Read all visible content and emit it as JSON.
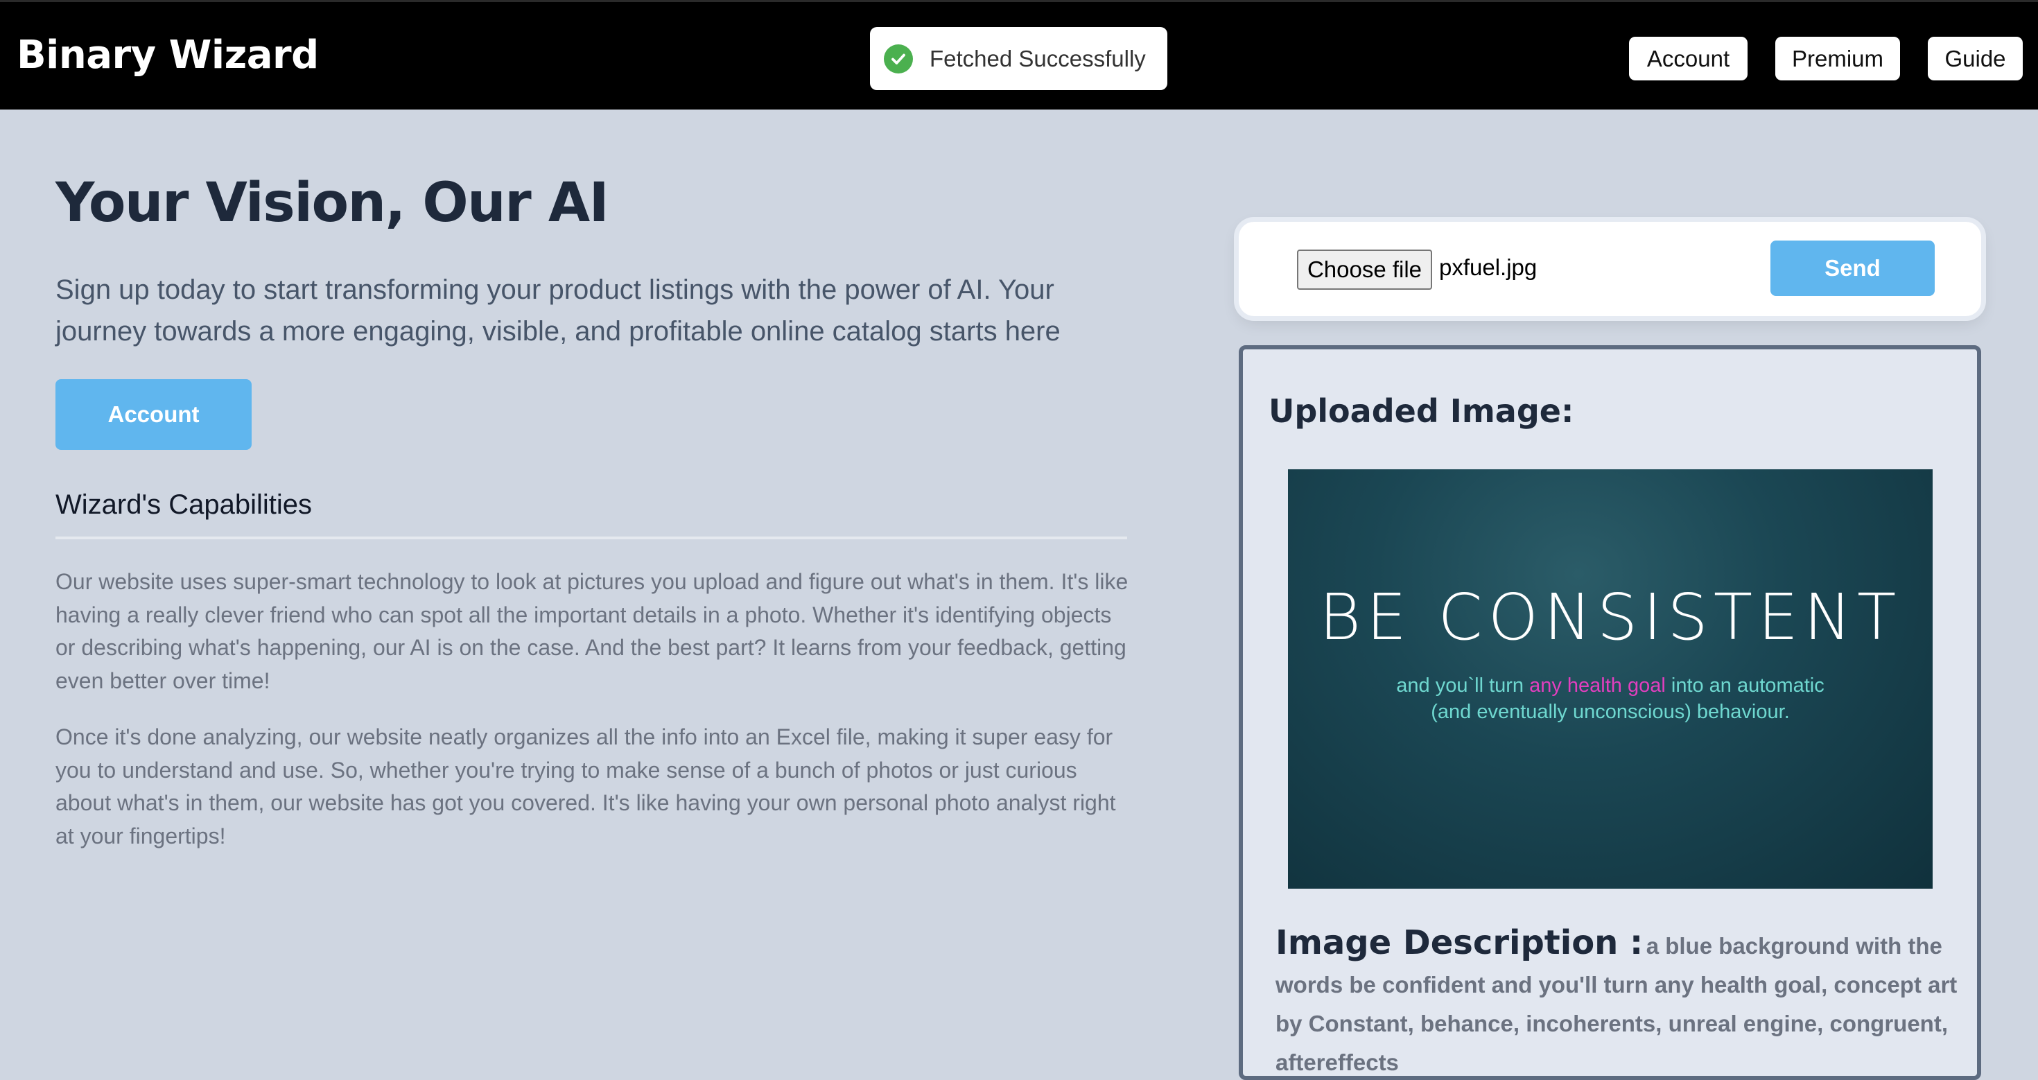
{
  "header": {
    "brand": "Binary Wizard",
    "toast": {
      "icon": "check-circle-icon",
      "text": "Fetched Successfully"
    },
    "nav": {
      "account": "Account",
      "premium": "Premium",
      "guide": "Guide"
    }
  },
  "hero": {
    "title": "Your Vision, Our AI",
    "subtitle": "Sign up today to start transforming your product listings with the power of AI. Your journey towards a more engaging, visible, and profitable online catalog starts here",
    "cta_label": "Account"
  },
  "capabilities": {
    "heading": "Wizard's Capabilities",
    "paragraphs": [
      "Our website uses super-smart technology to look at pictures you upload and figure out what's in them. It's like having a really clever friend who can spot all the important details in a photo. Whether it's identifying objects or describing what's happening, our AI is on the case. And the best part? It learns from your feedback, getting even better over time!",
      "Once it's done analyzing, our website neatly organizes all the info into an Excel file, making it super easy for you to understand and use. So, whether you're trying to make sense of a bunch of photos or just curious about what's in them, our website has got you covered. It's like having your own personal photo analyst right at your fingertips!"
    ]
  },
  "upload": {
    "choose_label": "Choose file",
    "file_name": "pxfuel.jpg",
    "send_label": "Send"
  },
  "result": {
    "heading": "Uploaded Image:",
    "image": {
      "title": "BE CONSISTENT",
      "line1_before": "and you`ll turn ",
      "line1_accent": "any health goal",
      "line1_after": " into an automatic",
      "line2": "(and eventually unconscious) behaviour."
    },
    "description_label": "Image Description :",
    "description_text": "a blue background with the words be confident and you'll turn any health goal, concept art by Constant, behance, incoherents, unreal engine, congruent, aftereffects"
  },
  "colors": {
    "page_bg": "#cfd6e1",
    "topbar_bg": "#000000",
    "accent_button": "#60b6ee",
    "success_green": "#4bb04f",
    "title_text": "#1e293b",
    "muted_text": "#6b7280",
    "image_accent": "#e23fbf"
  }
}
